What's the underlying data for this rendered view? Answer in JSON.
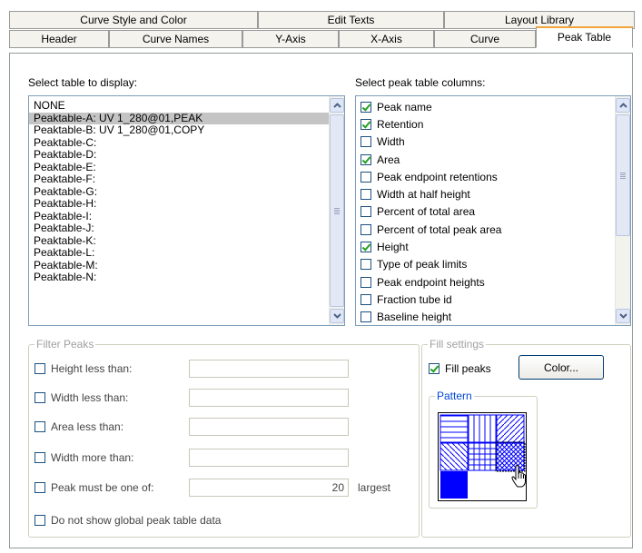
{
  "tabs_row1": [
    "Curve Style and Color",
    "Edit Texts",
    "Layout Library"
  ],
  "tabs_row2": [
    "Header",
    "Curve Names",
    "Y-Axis",
    "X-Axis",
    "Curve",
    "Peak Table"
  ],
  "active_tab": "Peak Table",
  "table_select": {
    "label": "Select table to display:",
    "items": [
      "NONE",
      "Peaktable-A: UV 1_280@01,PEAK",
      "Peaktable-B: UV 1_280@01,COPY",
      "Peaktable-C:",
      "Peaktable-D:",
      "Peaktable-E:",
      "Peaktable-F:",
      "Peaktable-G:",
      "Peaktable-H:",
      "Peaktable-I:",
      "Peaktable-J:",
      "Peaktable-K:",
      "Peaktable-L:",
      "Peaktable-M:",
      "Peaktable-N:"
    ],
    "selected": "Peaktable-A: UV 1_280@01,PEAK"
  },
  "columns_select": {
    "label": "Select peak table columns:",
    "items": [
      {
        "label": "Peak name",
        "checked": true
      },
      {
        "label": "Retention",
        "checked": true
      },
      {
        "label": "Width",
        "checked": false
      },
      {
        "label": "Area",
        "checked": true
      },
      {
        "label": "Peak endpoint retentions",
        "checked": false
      },
      {
        "label": "Width at half height",
        "checked": false
      },
      {
        "label": "Percent of total area",
        "checked": false
      },
      {
        "label": "Percent of total peak area",
        "checked": false
      },
      {
        "label": "Height",
        "checked": true
      },
      {
        "label": "Type of peak limits",
        "checked": false
      },
      {
        "label": "Peak endpoint heights",
        "checked": false
      },
      {
        "label": "Fraction tube id",
        "checked": false
      },
      {
        "label": "Baseline height",
        "checked": false
      }
    ]
  },
  "filter_peaks": {
    "title": "Filter Peaks",
    "rows": [
      {
        "label": "Height less than:",
        "value": ""
      },
      {
        "label": "Width less than:",
        "value": ""
      },
      {
        "label": "Area less than:",
        "value": ""
      },
      {
        "label": "Width more than:",
        "value": ""
      },
      {
        "label": "Peak must be one of:",
        "value": "20"
      }
    ],
    "suffix": "largest",
    "global_label": "Do not show global peak table data"
  },
  "fill_settings": {
    "title": "Fill settings",
    "fill_peaks_label": "Fill peaks",
    "fill_peaks_checked": true,
    "color_button": "Color...",
    "pattern_title": "Pattern",
    "selected_pattern": "cross-diagonal",
    "fill_color": "#0000ff"
  }
}
